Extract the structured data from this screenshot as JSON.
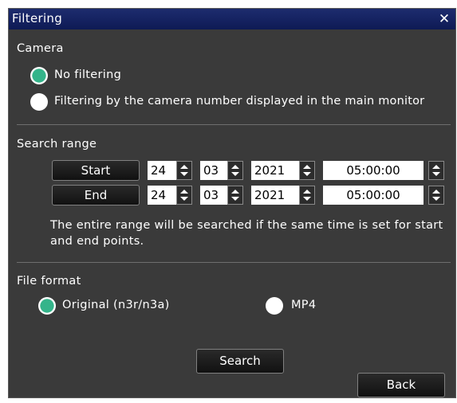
{
  "dialog": {
    "title": "Filtering",
    "close_symbol": "✕"
  },
  "camera": {
    "heading": "Camera",
    "options": [
      {
        "label": "No filtering",
        "selected": true
      },
      {
        "label": "Filtering by the camera number displayed in the main monitor",
        "selected": false
      }
    ]
  },
  "search_range": {
    "heading": "Search range",
    "start": {
      "button_label": "Start",
      "day": "24",
      "month": "03",
      "year": "2021",
      "time": "05:00:00"
    },
    "end": {
      "button_label": "End",
      "day": "24",
      "month": "03",
      "year": "2021",
      "time": "05:00:00"
    },
    "note": "The entire range will be searched if the same time is set for start and end points."
  },
  "file_format": {
    "heading": "File format",
    "options": [
      {
        "label": "Original (n3r/n3a)",
        "selected": true
      },
      {
        "label": "MP4",
        "selected": false
      }
    ]
  },
  "actions": {
    "search_label": "Search",
    "back_label": "Back"
  },
  "colors": {
    "title_bar": "#0e1a55",
    "panel": "#3a3a3a",
    "radio_selected": "#34b48a"
  }
}
